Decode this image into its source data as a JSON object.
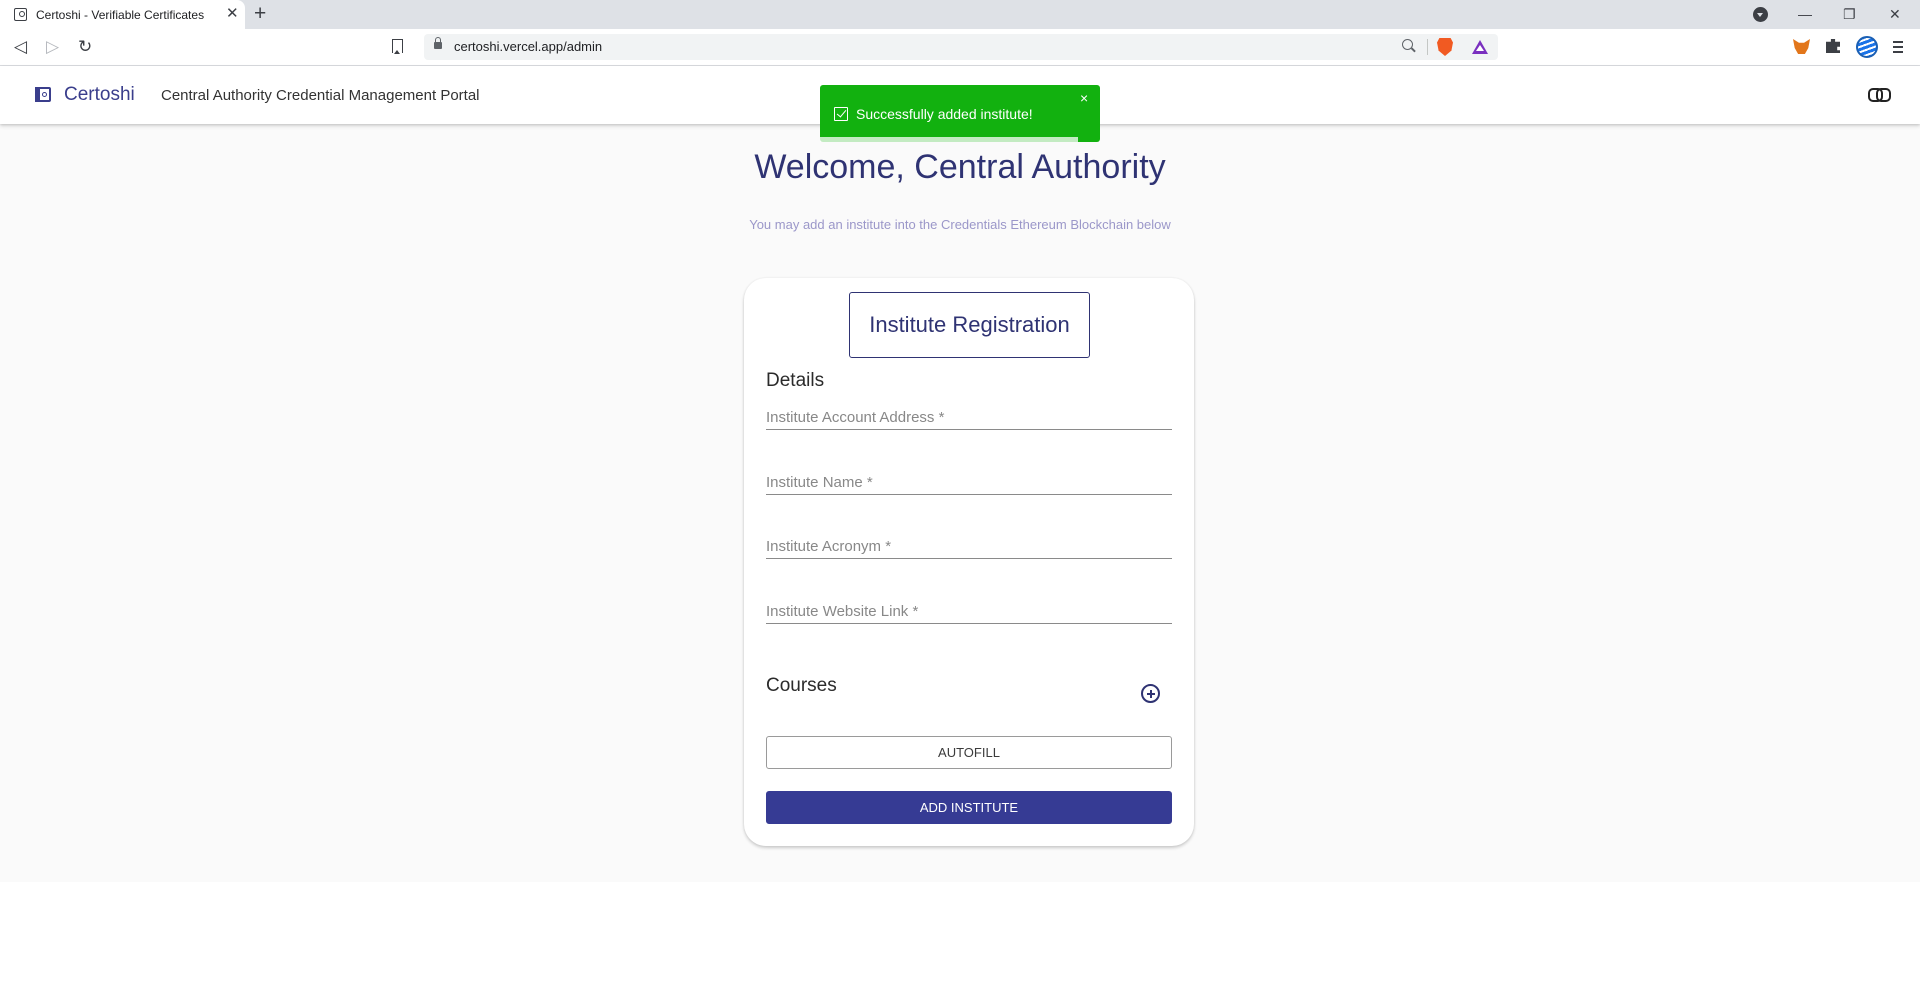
{
  "browser": {
    "tab_title": "Certoshi - Verifiable Certificates",
    "new_tab": "+",
    "tab_close": "✕",
    "url": "certoshi.vercel.app/admin",
    "window_controls": {
      "minimize": "—",
      "restore": "❐",
      "close": "✕"
    },
    "nav": {
      "back": "◁",
      "forward": "▷",
      "reload": "↻"
    },
    "icons": [
      "bookmark-icon",
      "lock-icon",
      "zoom-icon",
      "brave-shields-icon",
      "brave-rewards-icon",
      "metamask-fox-icon",
      "extensions-puzzle-icon",
      "profile-globe-icon",
      "menu-icon"
    ]
  },
  "app": {
    "brand": "Certoshi",
    "portal_title": "Central Authority Credential Management Portal",
    "toast": {
      "message": "Successfully added institute!",
      "close": "×",
      "color": "#12b10f",
      "progress_remaining": 0.92
    },
    "welcome": "Welcome, Central Authority",
    "subtitle": "You may add an institute into the Credentials Ethereum Blockchain below",
    "accent_color": "#363b94",
    "form": {
      "title": "Institute Registration",
      "details_label": "Details",
      "fields": [
        {
          "placeholder": "Institute Account Address *",
          "value": ""
        },
        {
          "placeholder": "Institute Name *",
          "value": ""
        },
        {
          "placeholder": "Institute Acronym *",
          "value": ""
        },
        {
          "placeholder": "Institute Website Link *",
          "value": ""
        }
      ],
      "courses_label": "Courses",
      "autofill_label": "AUTOFILL",
      "submit_label": "ADD INSTITUTE"
    }
  }
}
